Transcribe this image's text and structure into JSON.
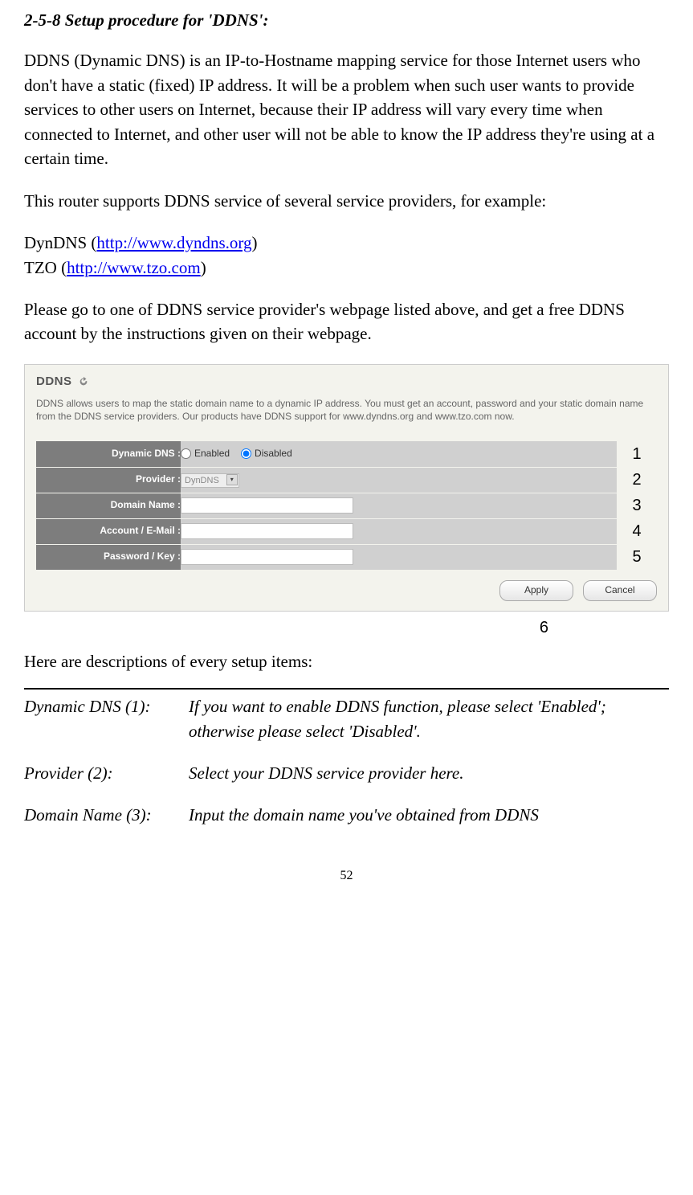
{
  "heading": "2-5-8 Setup procedure for 'DDNS':",
  "para1": "DDNS (Dynamic DNS) is an IP-to-Hostname mapping service for those Internet users who don't have a static (fixed) IP address. It will be a problem when such user wants to provide services to other users on Internet, because their IP address will vary every time when connected to Internet, and other user will not be able to know the IP address they're using at a certain time.",
  "para2": "This router supports DDNS service of several service providers, for example:",
  "provider_lines": {
    "dyndns_pre": "DynDNS (",
    "dyndns_link": "http://www.dyndns.org",
    "dyndns_post": ")",
    "tzo_pre": "TZO (",
    "tzo_link": "http://www.tzo.com",
    "tzo_post": ")"
  },
  "para3": "Please go to one of DDNS service provider's webpage listed above, and get a free DDNS account by the instructions given on their webpage.",
  "screenshot": {
    "title": "DDNS",
    "desc": "DDNS allows users to map the static domain name to a dynamic IP address. You must get an account, password and your static domain name from the DDNS service providers. Our products have DDNS support for www.dyndns.org and www.tzo.com now.",
    "rows": {
      "dynamic_dns": "Dynamic DNS :",
      "provider": "Provider :",
      "domain_name": "Domain Name :",
      "account": "Account / E-Mail :",
      "password": "Password / Key :"
    },
    "radio": {
      "enabled": "Enabled",
      "disabled": "Disabled"
    },
    "provider_value": "DynDNS",
    "callouts": {
      "c1": "1",
      "c2": "2",
      "c3": "3",
      "c4": "4",
      "c5": "5",
      "c6": "6"
    },
    "buttons": {
      "apply": "Apply",
      "cancel": "Cancel"
    }
  },
  "desc_intro": "Here are descriptions of every setup items:",
  "descriptions": {
    "d1_label": "Dynamic DNS (1):",
    "d1_text": "If you want to enable DDNS function, please select 'Enabled'; otherwise please select 'Disabled'.",
    "d2_label": "Provider (2):",
    "d2_text": "Select your DDNS service provider here.",
    "d3_label": "Domain Name (3):",
    "d3_text": "Input the domain name you've obtained from DDNS"
  },
  "page_number": "52"
}
